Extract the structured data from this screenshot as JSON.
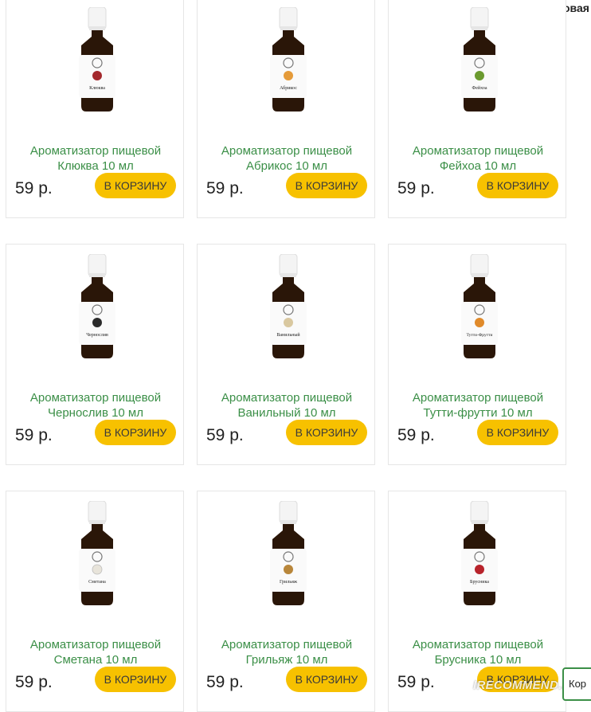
{
  "header": {
    "username": "КОКОСовая"
  },
  "products": [
    {
      "name_line1": "Ароматизатор пищевой",
      "name_line2": "Клюква 10 мл",
      "label": "Клюква",
      "price": "59 р.",
      "button": "В КОРЗИНУ",
      "accent": "#a3282c"
    },
    {
      "name_line1": "Ароматизатор пищевой",
      "name_line2": "Абрикос 10 мл",
      "label": "Абрикос",
      "price": "59 р.",
      "button": "В КОРЗИНУ",
      "accent": "#e59b3a"
    },
    {
      "name_line1": "Ароматизатор пищевой",
      "name_line2": "Фейхоа 10 мл",
      "label": "Фейхоа",
      "price": "59 р.",
      "button": "В КОРЗИНУ",
      "accent": "#6b9a2f"
    },
    {
      "name_line1": "Ароматизатор пищевой",
      "name_line2": "Чернослив 10 мл",
      "label": "Чернослив",
      "price": "59 р.",
      "button": "В КОРЗИНУ",
      "accent": "#2b2b2b"
    },
    {
      "name_line1": "Ароматизатор пищевой",
      "name_line2": "Ванильный 10 мл",
      "label": "Ванильный",
      "price": "59 р.",
      "button": "В КОРЗИНУ",
      "accent": "#d9c8a0"
    },
    {
      "name_line1": "Ароматизатор пищевой",
      "name_line2": "Тутти-фрутти 10 мл",
      "label": "Тутти-Фрутти",
      "price": "59 р.",
      "button": "В КОРЗИНУ",
      "accent": "#e08a2a"
    },
    {
      "name_line1": "Ароматизатор пищевой",
      "name_line2": "Сметана 10 мл",
      "label": "Сметана",
      "price": "59 р.",
      "button": "В КОРЗИНУ",
      "accent": "#e8e4da"
    },
    {
      "name_line1": "Ароматизатор пищевой",
      "name_line2": "Грильяж 10 мл",
      "label": "Грильяж",
      "price": "59 р.",
      "button": "В КОРЗИНУ",
      "accent": "#b8863a"
    },
    {
      "name_line1": "Ароматизатор пищевой",
      "name_line2": "Брусника 10 мл",
      "label": "Брусника",
      "price": "59 р.",
      "button": "В КОРЗИНУ",
      "accent": "#b8232b"
    }
  ],
  "watermark": "IRECOMMEND.RU",
  "edge_button": "Кор",
  "colors": {
    "button": "#f7c100",
    "product_name": "#3b8f47"
  }
}
